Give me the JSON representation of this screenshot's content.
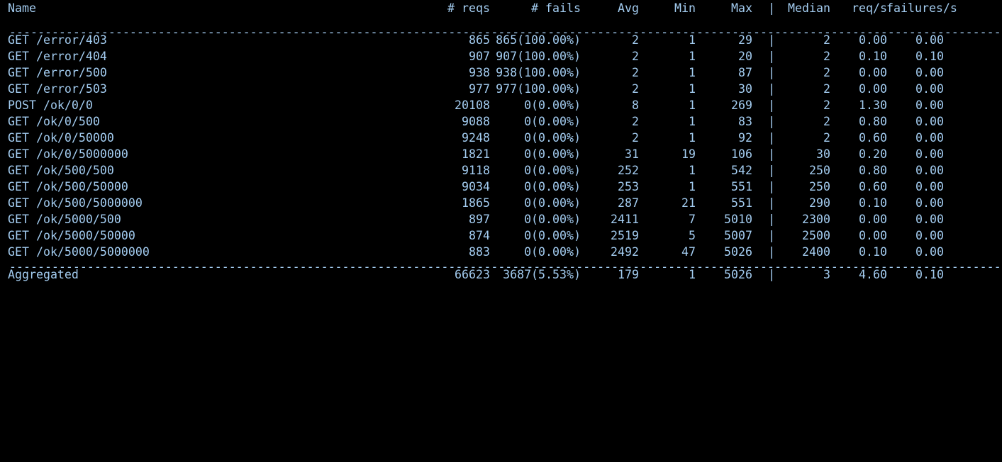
{
  "header": {
    "name": "Name",
    "reqs": "# reqs",
    "fails": "# fails",
    "avg": "Avg",
    "min": "Min",
    "max": "Max",
    "sep": "|",
    "median": "Median",
    "rps": "req/s",
    "fps": "failures/s"
  },
  "divider": "-----------------------------------------------------------------------------------------------------------------------------------------------------------------------",
  "rows": [
    {
      "name": "GET /error/403",
      "reqs": "865",
      "fails": "865(100.00%)",
      "avg": "2",
      "min": "1",
      "max": "29",
      "sep": "|",
      "median": "2",
      "rps": "0.00",
      "fps": "0.00"
    },
    {
      "name": "GET /error/404",
      "reqs": "907",
      "fails": "907(100.00%)",
      "avg": "2",
      "min": "1",
      "max": "20",
      "sep": "|",
      "median": "2",
      "rps": "0.10",
      "fps": "0.10"
    },
    {
      "name": "GET /error/500",
      "reqs": "938",
      "fails": "938(100.00%)",
      "avg": "2",
      "min": "1",
      "max": "87",
      "sep": "|",
      "median": "2",
      "rps": "0.00",
      "fps": "0.00"
    },
    {
      "name": "GET /error/503",
      "reqs": "977",
      "fails": "977(100.00%)",
      "avg": "2",
      "min": "1",
      "max": "30",
      "sep": "|",
      "median": "2",
      "rps": "0.00",
      "fps": "0.00"
    },
    {
      "name": "POST /ok/0/0",
      "reqs": "20108",
      "fails": "0(0.00%)",
      "avg": "8",
      "min": "1",
      "max": "269",
      "sep": "|",
      "median": "2",
      "rps": "1.30",
      "fps": "0.00"
    },
    {
      "name": "GET /ok/0/500",
      "reqs": "9088",
      "fails": "0(0.00%)",
      "avg": "2",
      "min": "1",
      "max": "83",
      "sep": "|",
      "median": "2",
      "rps": "0.80",
      "fps": "0.00"
    },
    {
      "name": "GET /ok/0/50000",
      "reqs": "9248",
      "fails": "0(0.00%)",
      "avg": "2",
      "min": "1",
      "max": "92",
      "sep": "|",
      "median": "2",
      "rps": "0.60",
      "fps": "0.00"
    },
    {
      "name": "GET /ok/0/5000000",
      "reqs": "1821",
      "fails": "0(0.00%)",
      "avg": "31",
      "min": "19",
      "max": "106",
      "sep": "|",
      "median": "30",
      "rps": "0.20",
      "fps": "0.00"
    },
    {
      "name": "GET /ok/500/500",
      "reqs": "9118",
      "fails": "0(0.00%)",
      "avg": "252",
      "min": "1",
      "max": "542",
      "sep": "|",
      "median": "250",
      "rps": "0.80",
      "fps": "0.00"
    },
    {
      "name": "GET /ok/500/50000",
      "reqs": "9034",
      "fails": "0(0.00%)",
      "avg": "253",
      "min": "1",
      "max": "551",
      "sep": "|",
      "median": "250",
      "rps": "0.60",
      "fps": "0.00"
    },
    {
      "name": "GET /ok/500/5000000",
      "reqs": "1865",
      "fails": "0(0.00%)",
      "avg": "287",
      "min": "21",
      "max": "551",
      "sep": "|",
      "median": "290",
      "rps": "0.10",
      "fps": "0.00"
    },
    {
      "name": "GET /ok/5000/500",
      "reqs": "897",
      "fails": "0(0.00%)",
      "avg": "2411",
      "min": "7",
      "max": "5010",
      "sep": "|",
      "median": "2300",
      "rps": "0.00",
      "fps": "0.00"
    },
    {
      "name": "GET /ok/5000/50000",
      "reqs": "874",
      "fails": "0(0.00%)",
      "avg": "2519",
      "min": "5",
      "max": "5007",
      "sep": "|",
      "median": "2500",
      "rps": "0.00",
      "fps": "0.00"
    },
    {
      "name": "GET /ok/5000/5000000",
      "reqs": "883",
      "fails": "0(0.00%)",
      "avg": "2492",
      "min": "47",
      "max": "5026",
      "sep": "|",
      "median": "2400",
      "rps": "0.10",
      "fps": "0.00"
    }
  ],
  "aggregated": {
    "name": "Aggregated",
    "reqs": "66623",
    "fails": "3687(5.53%)",
    "avg": "179",
    "min": "1",
    "max": "5026",
    "sep": "|",
    "median": "3",
    "rps": "4.60",
    "fps": "0.10"
  },
  "colors": {
    "background": "#000000",
    "text": "#a3ccf0"
  }
}
